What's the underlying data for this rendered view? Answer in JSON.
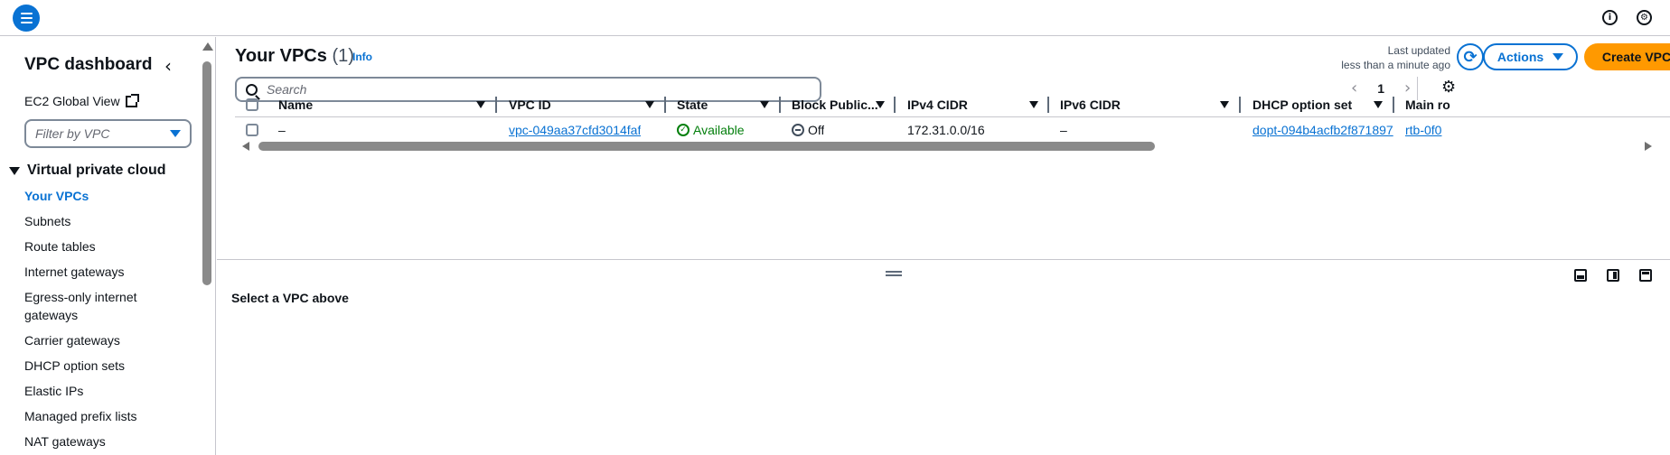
{
  "topbar": {
    "menu_icon": "hamburger-menu-icon",
    "info_icon": "i",
    "support_icon": "settings-icon"
  },
  "sidebar": {
    "title": "VPC dashboard",
    "ec2_link": "EC2 Global View",
    "filter_placeholder": "Filter by VPC",
    "section": "Virtual private cloud",
    "items": [
      {
        "label": "Your VPCs",
        "active": true
      },
      {
        "label": "Subnets"
      },
      {
        "label": "Route tables"
      },
      {
        "label": "Internet gateways"
      },
      {
        "label": "Egress-only internet gateways"
      },
      {
        "label": "Carrier gateways"
      },
      {
        "label": "DHCP option sets"
      },
      {
        "label": "Elastic IPs"
      },
      {
        "label": "Managed prefix lists"
      },
      {
        "label": "NAT gateways"
      }
    ]
  },
  "main": {
    "title": "Your VPCs",
    "count": "(1)",
    "info": "Info",
    "last_updated_label": "Last updated",
    "last_updated_value": "less than a minute ago",
    "actions_label": "Actions",
    "create_label": "Create VPC",
    "search_placeholder": "Search",
    "page_number": "1"
  },
  "table": {
    "columns": [
      "Name",
      "VPC ID",
      "State",
      "Block Public...",
      "IPv4 CIDR",
      "IPv6 CIDR",
      "DHCP option set",
      "Main ro"
    ],
    "rows": [
      {
        "name": "–",
        "vpc_id": "vpc-049aa37cfd3014faf",
        "state": "Available",
        "block_public": "Off",
        "ipv4_cidr": "172.31.0.0/16",
        "ipv6_cidr": "–",
        "dhcp_option_set": "dopt-094b4acfb2f871897",
        "main_route_table": "rtb-0f0"
      }
    ]
  },
  "split_panel": {
    "message": "Select a VPC above"
  },
  "colors": {
    "accent": "#0972d3",
    "primary_button": "#ff9900",
    "success": "#037f0c"
  }
}
